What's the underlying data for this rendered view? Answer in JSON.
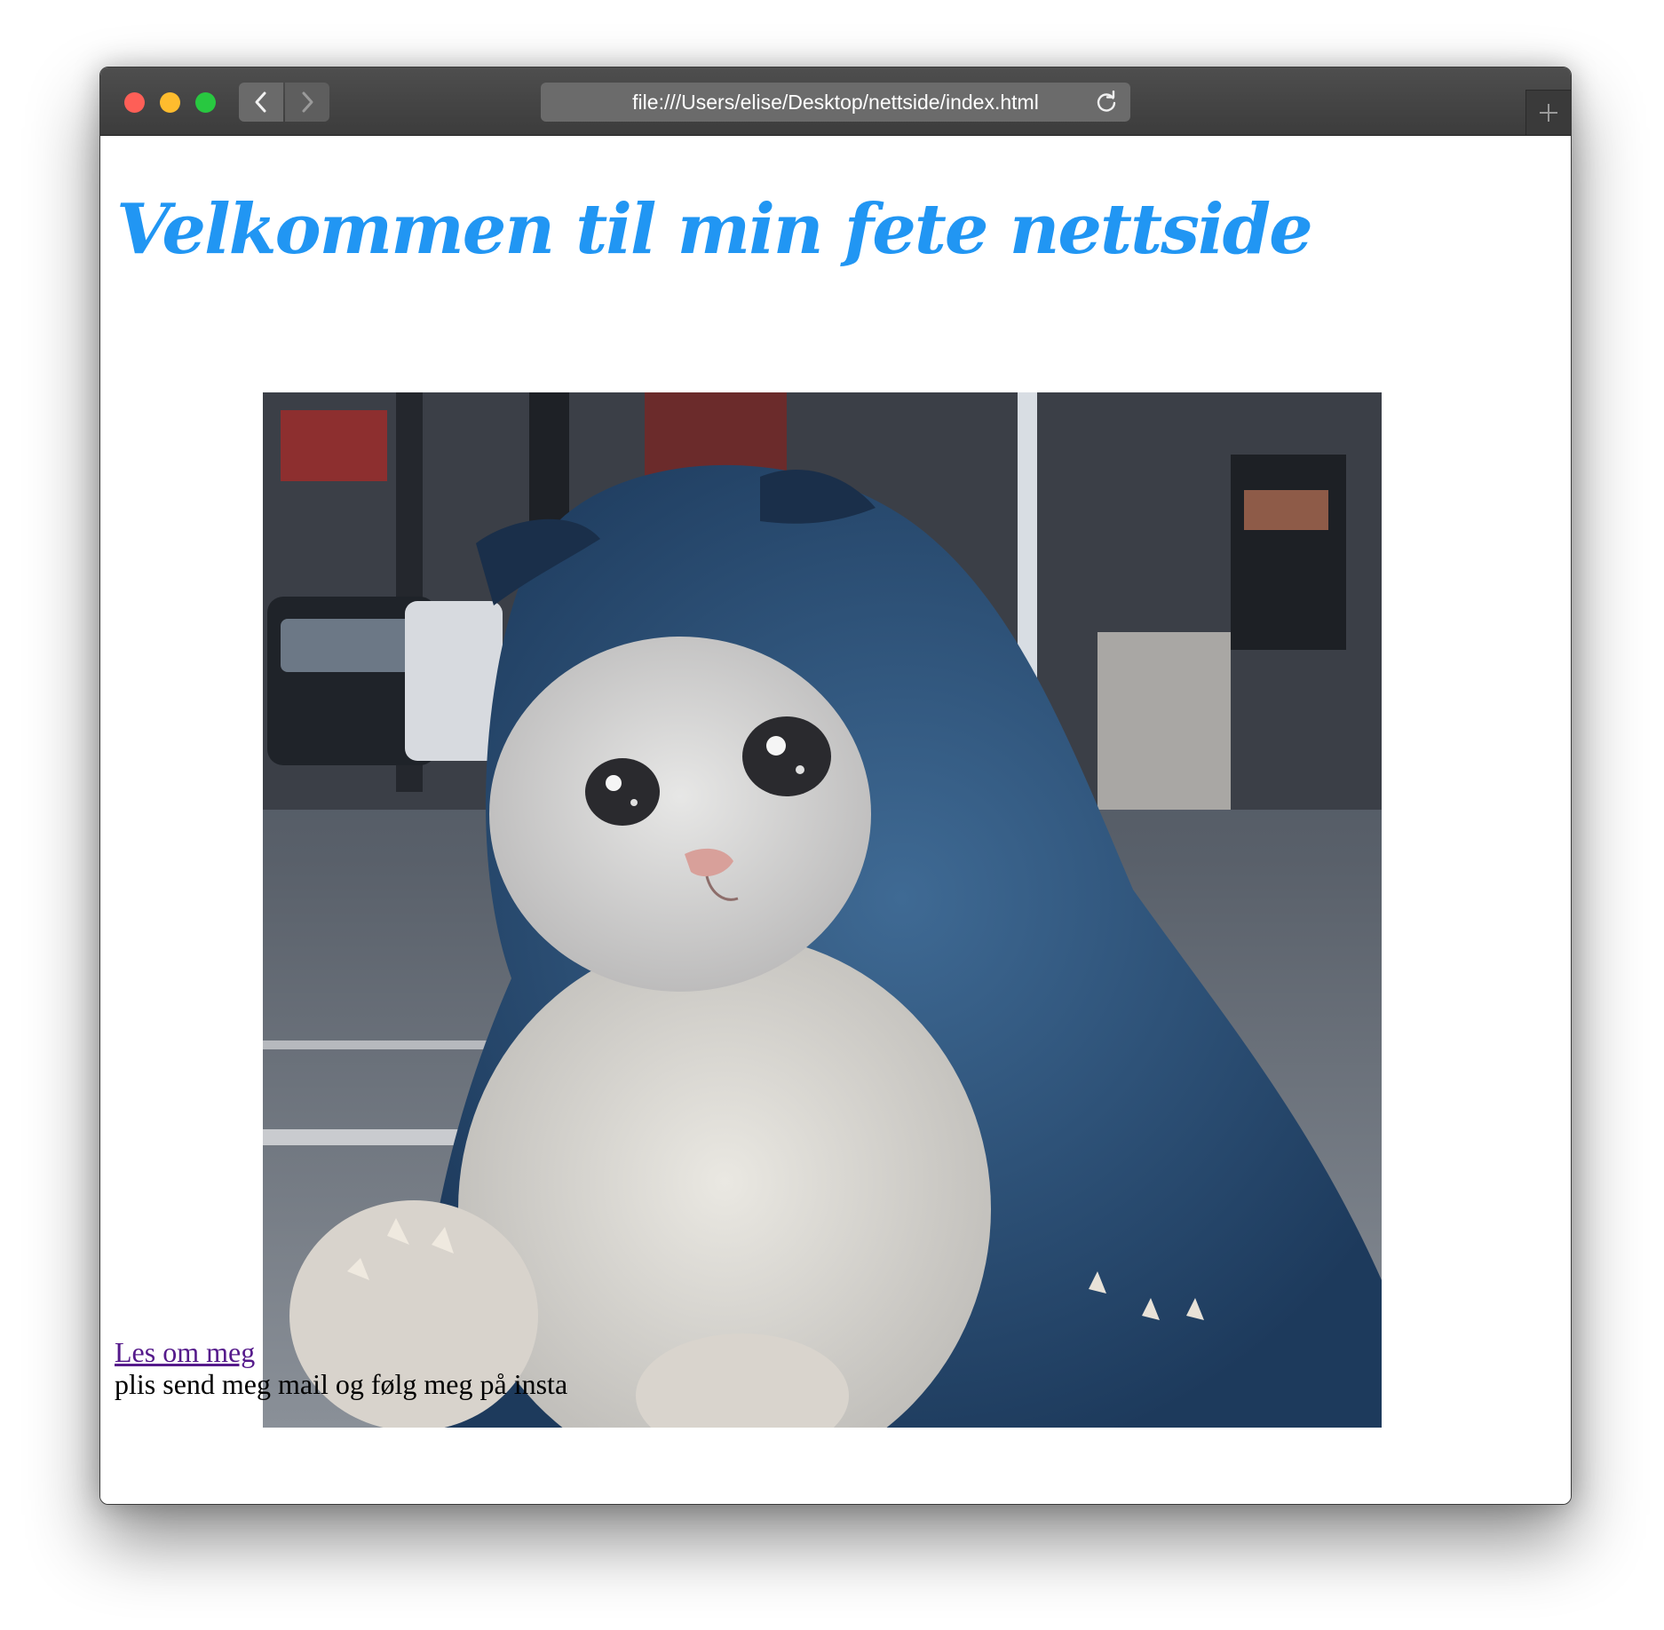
{
  "browser": {
    "url": "file:///Users/elise/Desktop/nettside/index.html"
  },
  "page": {
    "heading": "Velkommen til min fete nettside",
    "link_label": "Les om meg",
    "body_text": "plis send meg mail og følg meg på insta"
  },
  "colors": {
    "heading": "#2196f3",
    "visited_link": "#551a8b",
    "close_light": "#fe5f57",
    "minimize_light": "#febc2e",
    "zoom_light": "#28c840"
  }
}
